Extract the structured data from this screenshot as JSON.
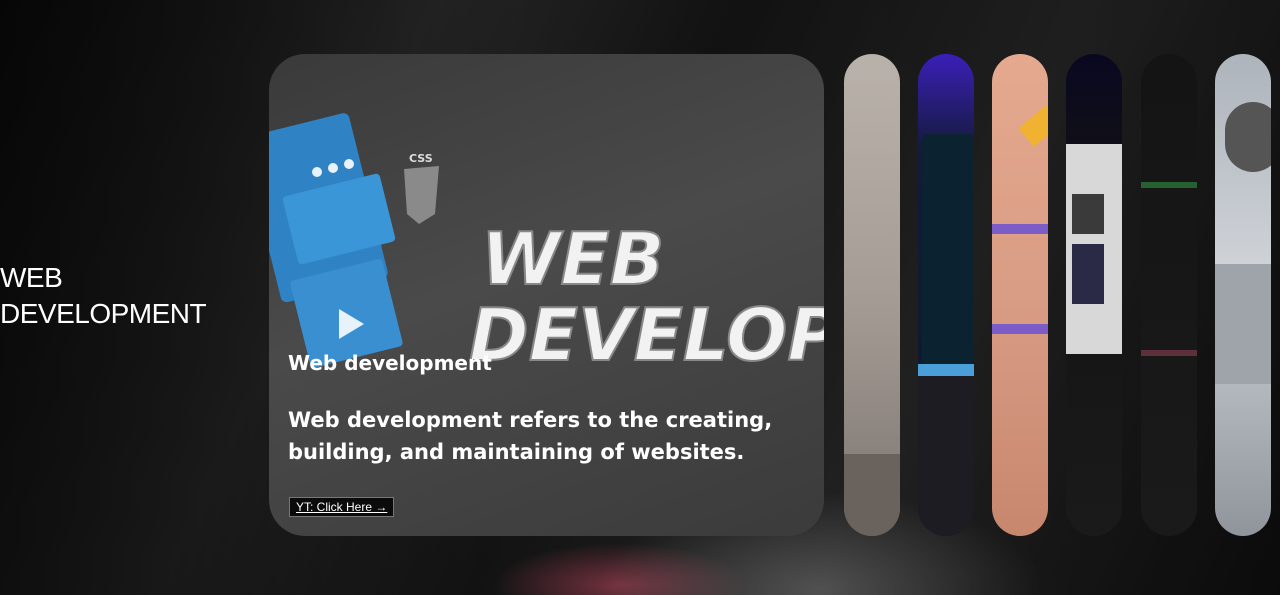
{
  "sidebar": {
    "title_line1": "WEB",
    "title_line2": "DEVELOPMENT"
  },
  "card": {
    "image_text_line1": "WEB",
    "image_text_line2": "DEVELOP",
    "css_badge": "CSS",
    "heading": "Web development",
    "description": "Web development refers to the creating, building, and maintaining of websites.",
    "link_label": "YT: Click Here →"
  },
  "thumbnails": [
    {
      "name": "thumb-beige",
      "icon": "abstract-image"
    },
    {
      "name": "thumb-laptop",
      "icon": "laptop-image"
    },
    {
      "name": "thumb-pink-3d",
      "icon": "3d-render-image"
    },
    {
      "name": "thumb-monitor",
      "icon": "monitor-image"
    },
    {
      "name": "thumb-dark-code",
      "icon": "code-image"
    },
    {
      "name": "thumb-camera",
      "icon": "camera-image"
    }
  ]
}
